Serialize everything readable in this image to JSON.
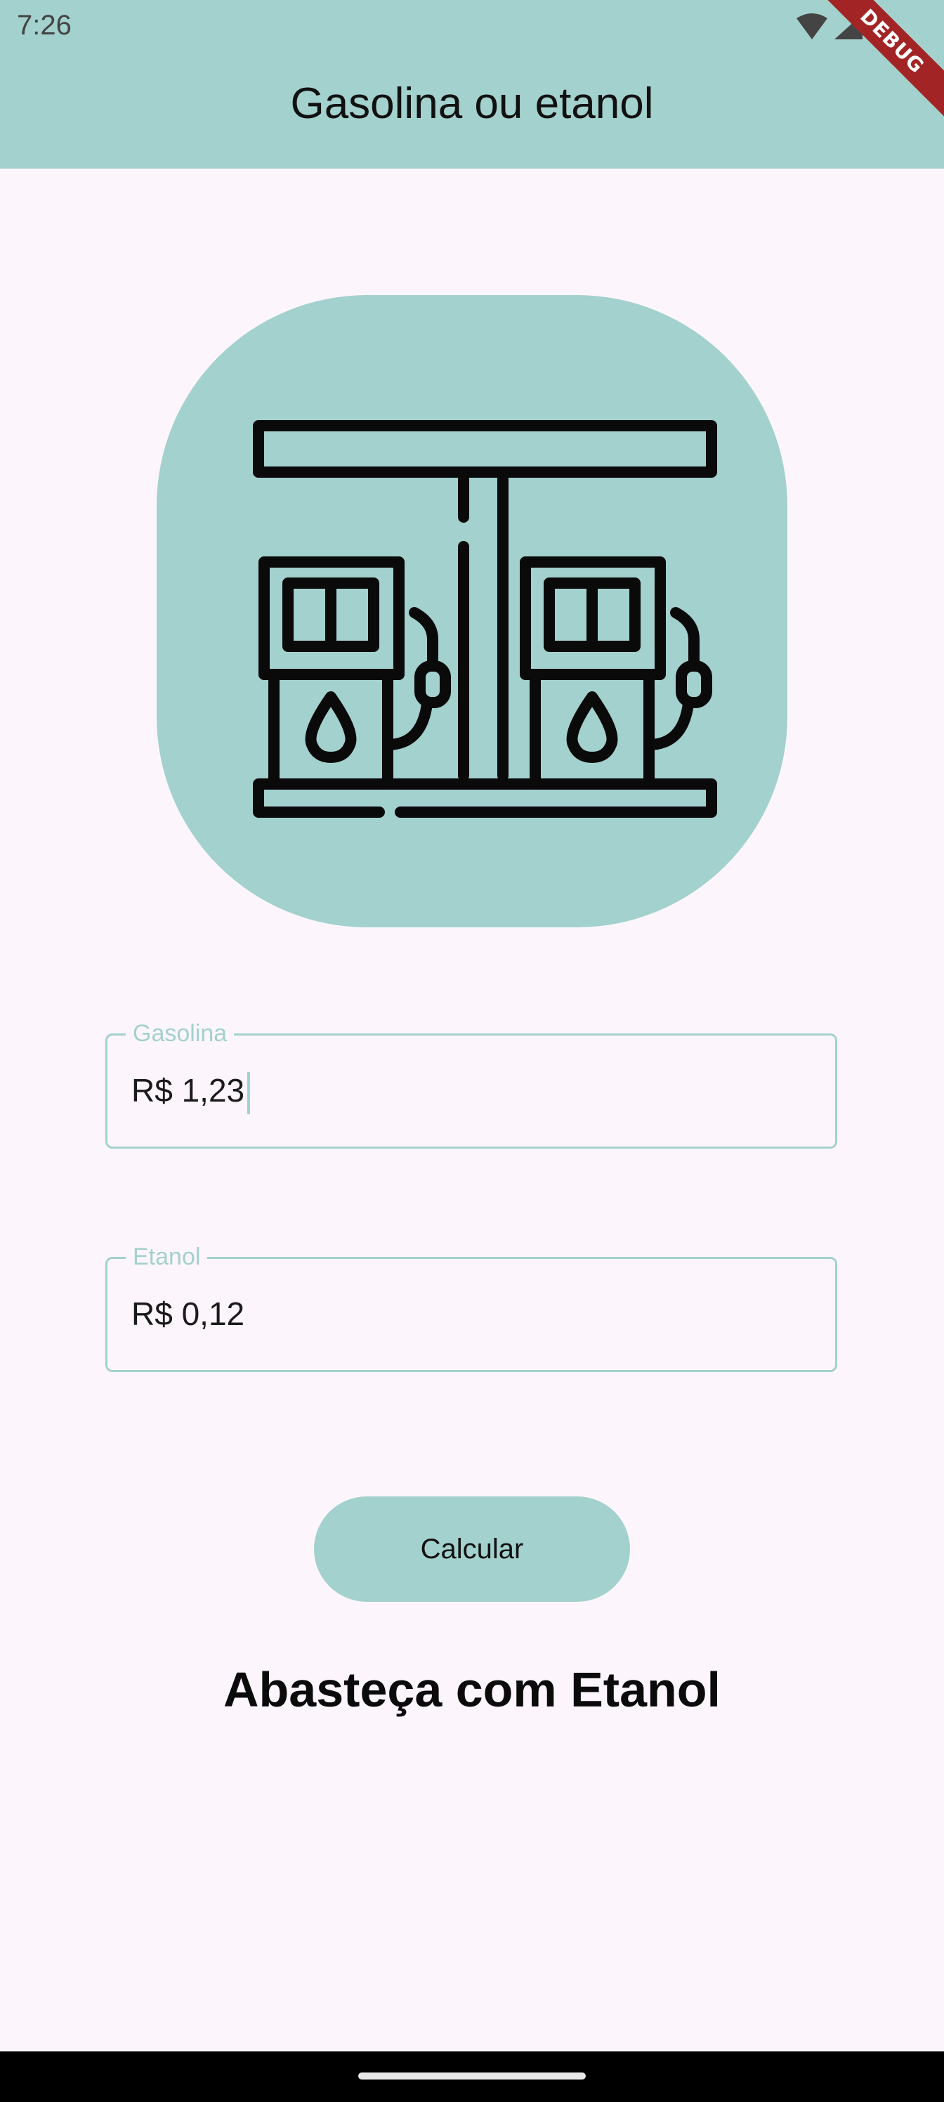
{
  "status_bar": {
    "time": "7:26"
  },
  "app_bar": {
    "title": "Gasolina ou etanol"
  },
  "debug_banner": "DEBUG",
  "logo": {
    "icon": "gas-station-pumps-icon",
    "background_color": "#a3d1cd"
  },
  "form": {
    "gasolina": {
      "label": "Gasolina",
      "value": "R$ 1,23"
    },
    "etanol": {
      "label": "Etanol",
      "value": "R$ 0,12"
    }
  },
  "calculate_button": {
    "label": "Calcular"
  },
  "result": {
    "text": "Abasteça com Etanol"
  },
  "colors": {
    "accent": "#a3d1cd",
    "background": "#fcf6fc",
    "debug": "#a32424"
  }
}
